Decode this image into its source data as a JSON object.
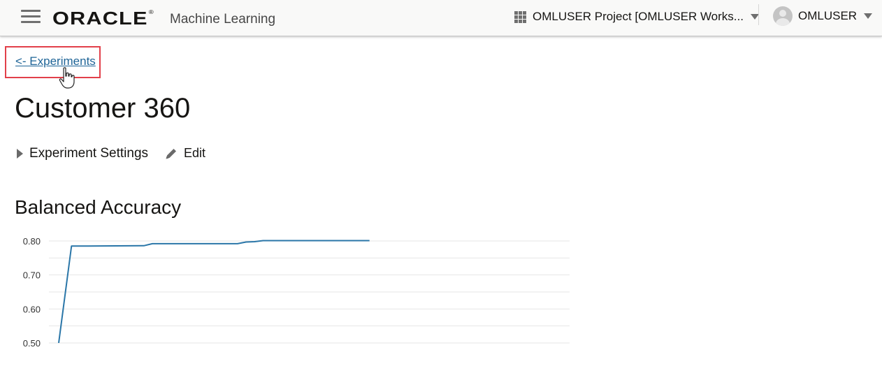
{
  "header": {
    "logo_text": "ORACLE",
    "logo_mark": "®",
    "app_name": "Machine Learning",
    "project_label": "OMLUSER Project [OMLUSER Works...",
    "user_name": "OMLUSER"
  },
  "nav": {
    "back_link": "<- Experiments"
  },
  "page": {
    "title": "Customer 360",
    "settings_label": "Experiment Settings",
    "edit_label": "Edit"
  },
  "icons": {
    "menu": "hamburger-menu-icon",
    "apps": "grid-icon",
    "dropdown": "caret-down-icon",
    "avatar": "user-avatar-icon",
    "expand": "triangle-right-icon",
    "edit": "pencil-icon",
    "cursor": "hand-pointer-icon"
  },
  "colors": {
    "accent_link": "#1e6497",
    "highlight_box": "#e2404a",
    "line_series": "#2a76a8"
  },
  "chart_data": {
    "type": "line",
    "title": "Balanced Accuracy",
    "xlabel": "",
    "ylabel": "",
    "ylim": [
      0.5,
      0.8
    ],
    "yticks": [
      "0.80",
      "0.70",
      "0.60",
      "0.50"
    ],
    "grid": true,
    "x": [
      0,
      3,
      4,
      20,
      22,
      42,
      44,
      46,
      48,
      73
    ],
    "values": [
      0.5,
      0.785,
      0.785,
      0.786,
      0.792,
      0.792,
      0.797,
      0.798,
      0.801,
      0.801
    ]
  }
}
